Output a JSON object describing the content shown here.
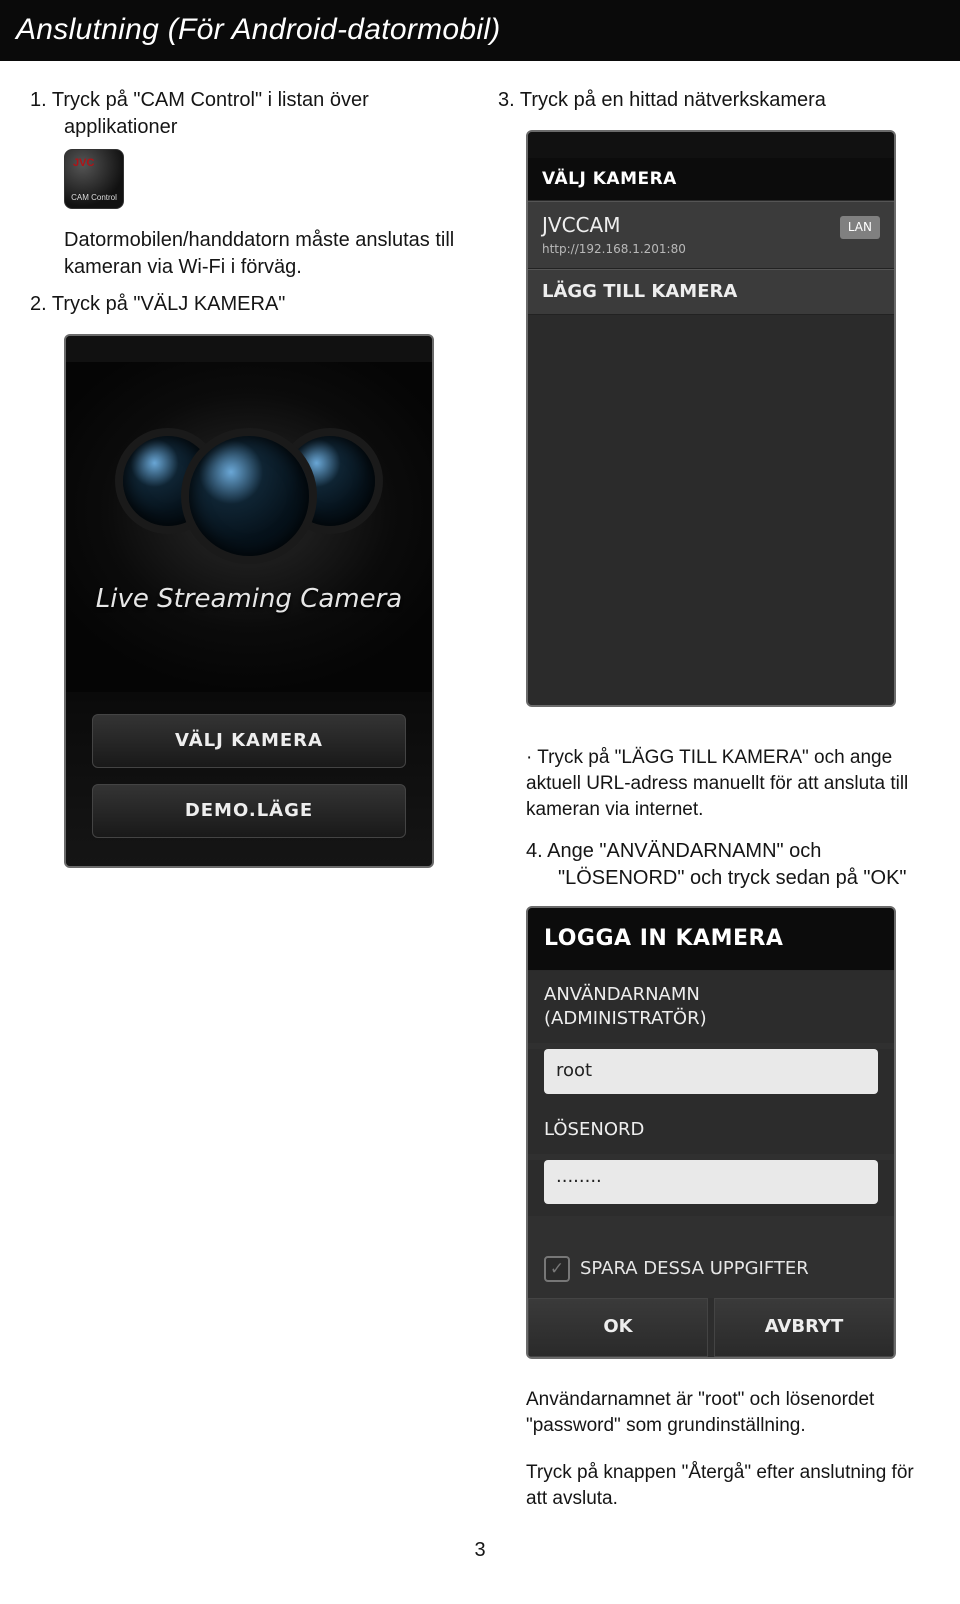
{
  "header": "Anslutning (För Android-datormobil)",
  "left": {
    "step1": "1. Tryck på \"CAM Control\" i listan över applikationer",
    "iconLabel": "CAM Control",
    "iconBrand": "JVC",
    "note": "Datormobilen/handdatorn måste anslutas till kameran via Wi-Fi i förväg.",
    "step2": "2. Tryck på \"VÄLJ KAMERA\"",
    "heroTitle": "Live Streaming Camera",
    "btn1": "VÄLJ KAMERA",
    "btn2": "DEMO.LÄGE"
  },
  "right": {
    "step3": "3. Tryck på en hittad nätverkskamera",
    "title": "VÄLJ KAMERA",
    "camName": "JVCCAM",
    "camUrl": "http://192.168.1.201:80",
    "lan": "LAN",
    "addCam": "LÄGG TILL KAMERA",
    "bullet": "· Tryck på \"LÄGG TILL KAMERA\" och ange aktuell URL-adress manuellt för att ansluta till kameran via internet.",
    "step4": "4. Ange \"ANVÄNDARNAMN\" och \"LÖSENORD\" och tryck sedan på \"OK\"",
    "loginTitle": "LOGGA IN KAMERA",
    "userLbl": "ANVÄNDARNAMN\n(ADMINISTRATÖR)",
    "userVal": "root",
    "passLbl": "LÖSENORD",
    "passVal": "········",
    "save": "SPARA DESSA UPPGIFTER",
    "ok": "OK",
    "cancel": "AVBRYT",
    "noteUser": "Användarnamnet är \"root\" och lösenordet \"password\" som grundinställning.",
    "noteExit": "Tryck på knappen \"Återgå\" efter anslutning för att avsluta."
  },
  "pageNum": "3"
}
